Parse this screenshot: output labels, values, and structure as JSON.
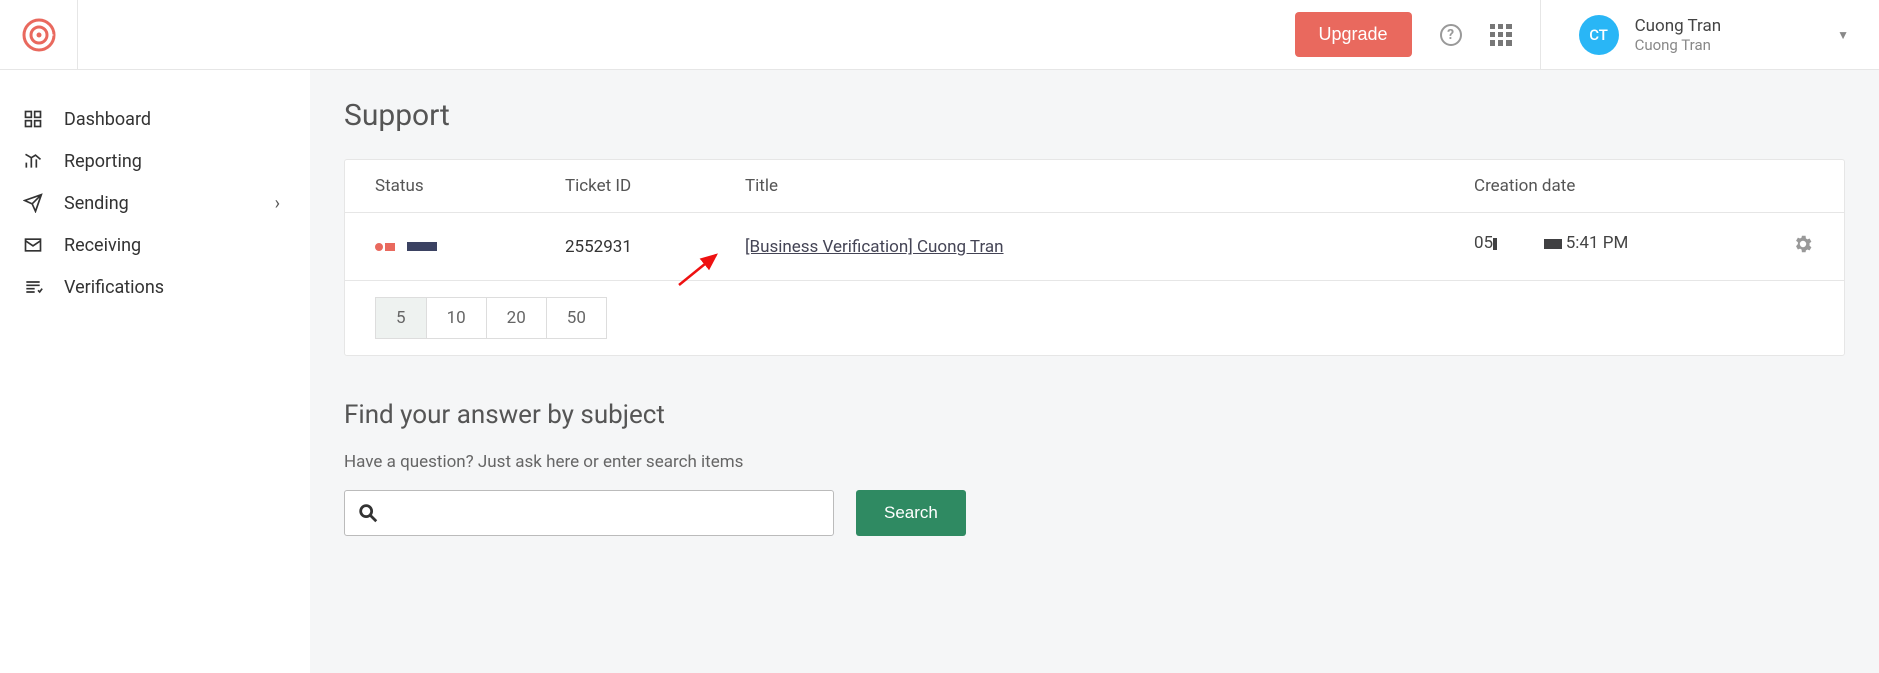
{
  "header": {
    "upgrade_label": "Upgrade",
    "avatar_initials": "CT",
    "user_name": "Cuong Tran",
    "user_sub": "Cuong Tran"
  },
  "sidebar": {
    "items": [
      {
        "label": "Dashboard"
      },
      {
        "label": "Reporting"
      },
      {
        "label": "Sending"
      },
      {
        "label": "Receiving"
      },
      {
        "label": "Verifications"
      }
    ]
  },
  "page": {
    "title": "Support",
    "table": {
      "headers": {
        "status": "Status",
        "ticket": "Ticket ID",
        "title": "Title",
        "date": "Creation date"
      },
      "rows": [
        {
          "ticket_id": "2552931",
          "title": "[Business Verification] Cuong Tran",
          "date_prefix": "05",
          "date_time": "5:41 PM"
        }
      ]
    },
    "pager": [
      "5",
      "10",
      "20",
      "50"
    ],
    "pager_active": "5",
    "find_title": "Find your answer by subject",
    "find_desc": "Have a question? Just ask here or enter search items",
    "search_label": "Search"
  }
}
